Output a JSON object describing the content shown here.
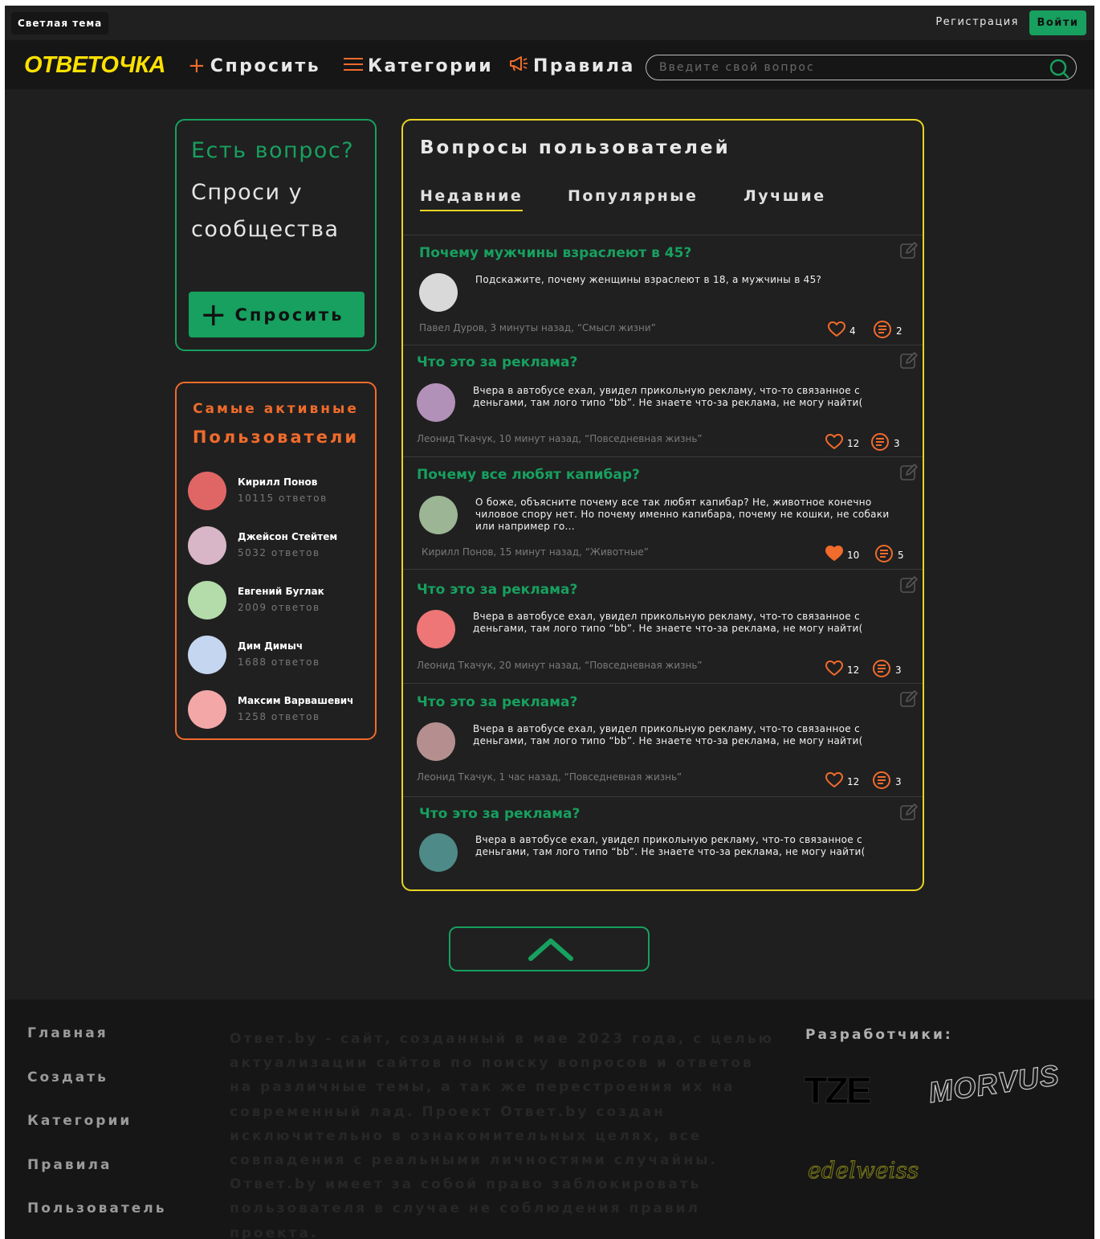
{
  "topbar": {
    "theme_toggle": "Светлая тема",
    "register": "Регистрация",
    "login": "Войти"
  },
  "nav": {
    "logo": "ОТВЕТОЧКА",
    "ask": "Спросить",
    "categories": "Категории",
    "rules": "Правила",
    "search_placeholder": "Введите свой вопрос"
  },
  "ask_card": {
    "title": "Есть вопрос?",
    "subtitle": "Спроси у сообщества",
    "button": "Спросить"
  },
  "active_users": {
    "title_line1": "Самые активные",
    "title_line2": "Пользователи",
    "users": [
      {
        "name": "Кирилл Понов",
        "count": "10115 ответов",
        "color": "#e06666"
      },
      {
        "name": "Джейсон Стейтем",
        "count": "5032 ответов",
        "color": "#d9b5c8"
      },
      {
        "name": "Евгений Буглак",
        "count": "2009 ответов",
        "color": "#b4dcaa"
      },
      {
        "name": "Дим Димыч",
        "count": "1688 ответов",
        "color": "#c5d6f0"
      },
      {
        "name": "Максим Варвашевич",
        "count": "1258 ответов",
        "color": "#f4a7a7"
      }
    ]
  },
  "questions": {
    "heading": "Вопросы пользователей",
    "tabs": [
      "Недавние",
      "Популярные",
      "Лучшие"
    ],
    "active_tab": "Недавние",
    "items": [
      {
        "title": "Почему мужчины взраслеют в 45?",
        "body": "Подскажите, почему женщины взраслеют в 18, а мужчины в 45?",
        "meta": "Павел Дуров, 3 минуты назад, “Смысл жизни”",
        "likes": "4",
        "comments": "2",
        "liked": false,
        "avatar": "#d9d9d9"
      },
      {
        "title": "Что это за реклама?",
        "body": "Вчера в автобусе ехал, увидел прикольную рекламу, что-то связанное с деньгами, там лого типо “bb”. Не знаете что-за реклама, не могу найти(",
        "meta": "Леонид Ткачук, 10 минут назад, “Повседневная жизнь”",
        "likes": "12",
        "comments": "3",
        "liked": false,
        "avatar": "#b291b8"
      },
      {
        "title": "Почему все любят капибар?",
        "body": "О боже, объясните почему все так любят капибар? Не, животное конечно чиловое спору нет. Но почему именно капибара, почему не кошки, не собаки или например го...",
        "meta": "Кирилл Понов, 15 минут назад, “Животные”",
        "likes": "10",
        "comments": "5",
        "liked": true,
        "avatar": "#9bb595"
      },
      {
        "title": "Что это за реклама?",
        "body": "Вчера в автобусе ехал, увидел прикольную рекламу, что-то связанное с деньгами, там лого типо “bb”. Не знаете что-за реклама, не могу найти(",
        "meta": "Леонид Ткачук, 20 минут назад, “Повседневная жизнь”",
        "likes": "12",
        "comments": "3",
        "liked": false,
        "avatar": "#ee7676"
      },
      {
        "title": "Что это за реклама?",
        "body": "Вчера в автобусе ехал, увидел прикольную рекламу, что-то связанное с деньгами, там лого типо “bb”. Не знаете что-за реклама, не могу найти(",
        "meta": "Леонид Ткачук, 1 час назад, “Повседневная жизнь”",
        "likes": "12",
        "comments": "3",
        "liked": false,
        "avatar": "#b58f8f"
      },
      {
        "title": "Что это за реклама?",
        "body": "Вчера в автобусе ехал, увидел прикольную рекламу, что-то связанное с деньгами, там лого типо “bb”. Не знаете что-за реклама, не могу найти(",
        "meta": "",
        "likes": "",
        "comments": "",
        "liked": false,
        "avatar": "#4e8a88"
      }
    ]
  },
  "footer": {
    "links": [
      "Главная",
      "Создать",
      "Категории",
      "Правила",
      "Пользователь"
    ],
    "about": "Ответ.by - сайт, созданный в мае 2023 года, с целью актуализации сайтов по поиску вопросов и ответов на различные темы, а так же перестроения их на современный лад. Проект Ответ.by создан исключительно в ознакомительных целях, все совпадения с реальными личностями случайны. Ответ.by имеет за собой право заблокировать пользователя в случае не соблюдения правил проекта.",
    "developers_label": "Разработчики:",
    "dev_logos": [
      "TZE",
      "MORVUS",
      "edelweiss"
    ]
  },
  "colors": {
    "accent_green": "#17a05f",
    "accent_orange": "#f06b2c",
    "accent_yellow": "#e8d423",
    "logo_yellow": "#ffe100",
    "background": "#1f1f1f"
  },
  "icons": [
    "plus-icon",
    "menu-icon",
    "megaphone-icon",
    "search-icon",
    "edit-icon",
    "heart-icon",
    "comment-icon",
    "chevron-up-icon"
  ]
}
